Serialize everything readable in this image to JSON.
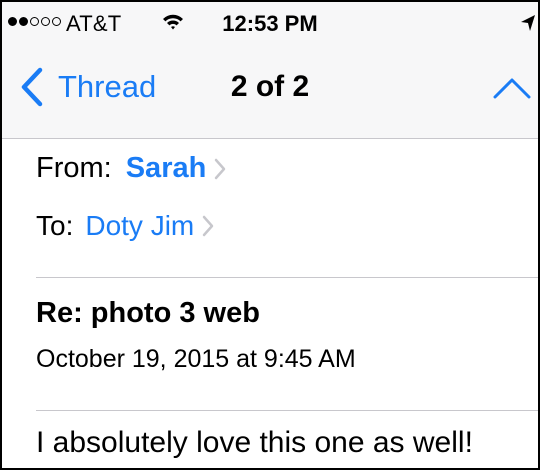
{
  "status_bar": {
    "carrier": "AT&T",
    "time": "12:53 PM",
    "signal_bars_filled": 2,
    "signal_bars_total": 5,
    "icons": [
      "wifi-icon",
      "location-arrow-icon"
    ]
  },
  "nav": {
    "back_label": "Thread",
    "title": "2 of 2",
    "icons": [
      "chevron-left-icon",
      "chevron-up-icon"
    ]
  },
  "message": {
    "from_label": "From:",
    "sender": "Sarah",
    "to_label": "To:",
    "recipient": "Doty Jim",
    "subject": "Re: photo 3 web",
    "date": "October 19, 2015 at 9:45 AM",
    "body": "I absolutely love this one as well!"
  },
  "colors": {
    "accent": "#1a7cf5",
    "bar_background": "#f7f7f8",
    "separator": "#c8c7cc"
  }
}
